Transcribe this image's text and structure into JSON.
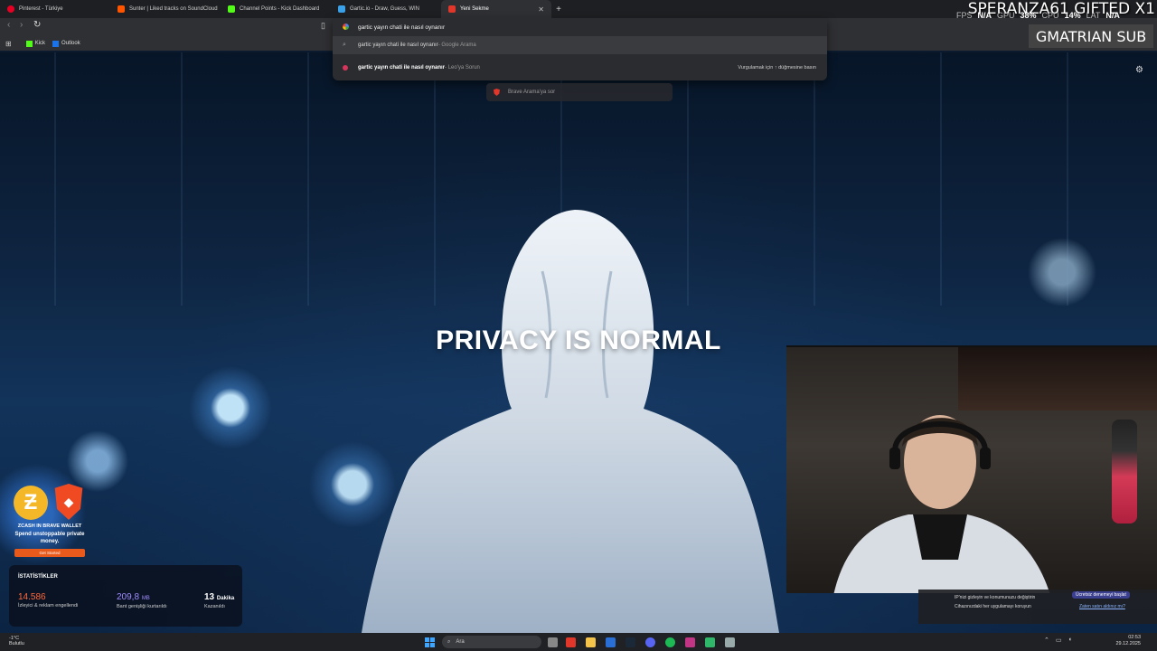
{
  "tabs": [
    {
      "title": "Pinterest - Türkiye",
      "color": "#e60023"
    },
    {
      "title": "Sunter | Liked tracks on SoundCloud",
      "color": "#ff5500"
    },
    {
      "title": "Channel Points - Kick Dashboard",
      "color": "#53fc18"
    },
    {
      "title": "Gartic.io - Draw, Guess, WIN",
      "color": "#3aa0e8"
    },
    {
      "title": "Yeni Sekme",
      "color": "#e0372a",
      "active": true
    }
  ],
  "omnibox": {
    "value": "gartic yayın chati ile nasıl oynanır",
    "suggestions": [
      {
        "text": "gartic yayın chati ile nasıl oynanır",
        "source": " - Google Arama"
      },
      {
        "text_bold": "gartic yayın chati ile nasıl oynanır",
        "source": " - Leo'ya Sorun",
        "hint": "Vurgulamak için ↑ düğmesine basın"
      }
    ]
  },
  "bookmarks": [
    {
      "label": "Kick",
      "color": "#53fc18"
    },
    {
      "label": "Outlook",
      "color": "#1a73e8"
    }
  ],
  "ask_brave": "Brave Arama'ya sor",
  "headline": "PRIVACY IS NORMAL",
  "overlay": {
    "marquee": "SPERANZA61 GIFTED X1",
    "fps_label": "FPS",
    "fps_value": "N/A",
    "gpu_label": "GPU",
    "gpu_value": "38%",
    "cpu_label": "CPU",
    "cpu_value": "14%",
    "lat_label": "LAT",
    "lat_value": "N/A",
    "sub_text": "GMATRIAN SUB"
  },
  "zcash": {
    "title": "ZCASH IN BRAVE WALLET",
    "subtitle": "Spend unstoppable private money.",
    "button": "Get Started"
  },
  "stats": {
    "title": "İSTATİSTİKLER",
    "items": [
      {
        "value": "14.586",
        "unit": "",
        "label": "İzleyici & reklam engellendi",
        "color": "#ff6a3d"
      },
      {
        "value": "209,8",
        "unit": "MB",
        "label": "Bant genişliği kurtarıldı",
        "color": "#a08cff"
      },
      {
        "value": "13",
        "unit": "Dakika",
        "label": "Kazanıldı",
        "color": "#ffffff"
      }
    ]
  },
  "vpn_popup": {
    "line1": "IP'nizi gizleyin ve konumunuzu değiştirin",
    "line2": "Cihazınızdaki her uygulamayı koruyun",
    "cta": "Ücretsiz denemeyi başlat",
    "link": "Zaten satın aldınız mı?"
  },
  "taskbar": {
    "weather_temp": "-1°C",
    "weather_desc": "Bulutlu",
    "search_label": "Ara",
    "time": "02:53",
    "date": "29.12.2025"
  }
}
